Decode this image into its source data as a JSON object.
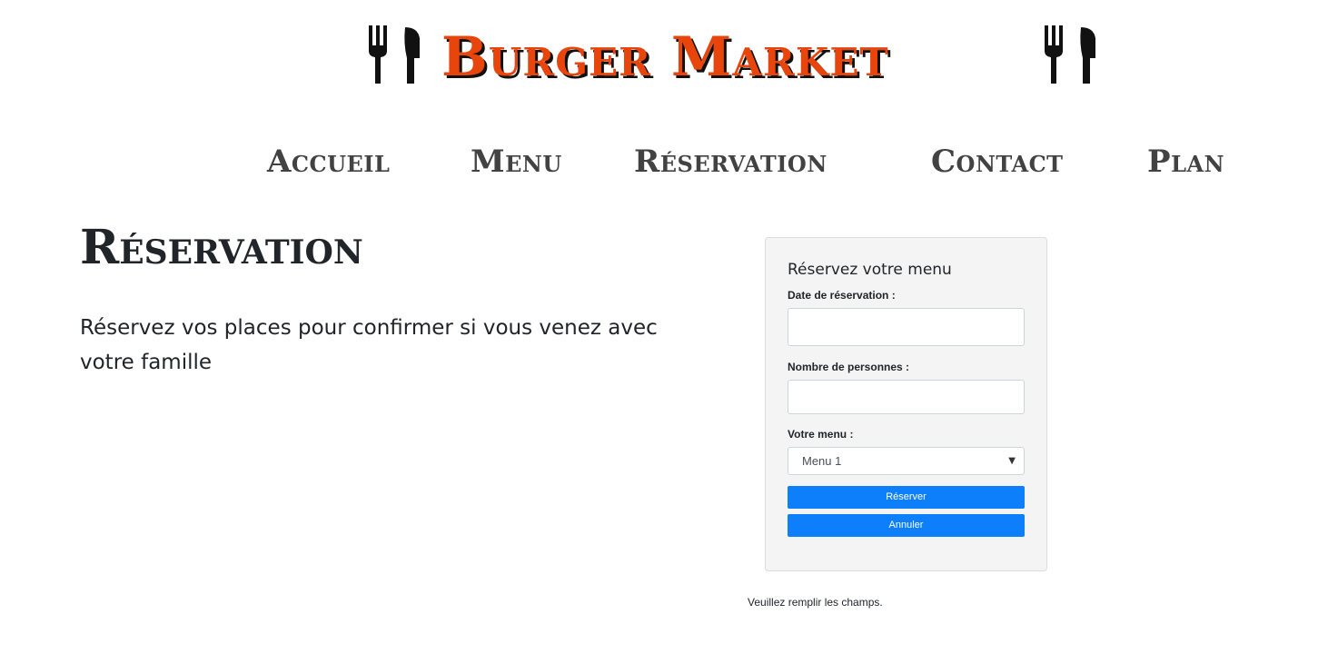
{
  "brand": {
    "title": "Burger Market",
    "title_color": "#e8450c",
    "left_icon": "fork-knife-icon",
    "right_icon": "fork-knife-icon"
  },
  "nav": {
    "items": [
      {
        "label": "Accueil"
      },
      {
        "label": "Menu"
      },
      {
        "label": "Réservation"
      },
      {
        "label": "Contact"
      },
      {
        "label": "Plan"
      }
    ]
  },
  "main": {
    "heading": "Réservation",
    "intro": "Réservez vos places pour confirmer si vous venez avec votre famille"
  },
  "form": {
    "title": "Réservez votre menu",
    "date_label": "Date de réservation :",
    "date_value": "",
    "people_label": "Nombre de personnes :",
    "people_value": "",
    "menu_label": "Votre menu :",
    "menu_selected": "Menu 1",
    "reserve_label": "Réserver",
    "cancel_label": "Annuler",
    "button_color": "#0d7ffb"
  },
  "notice": "Veuillez remplir les champs."
}
